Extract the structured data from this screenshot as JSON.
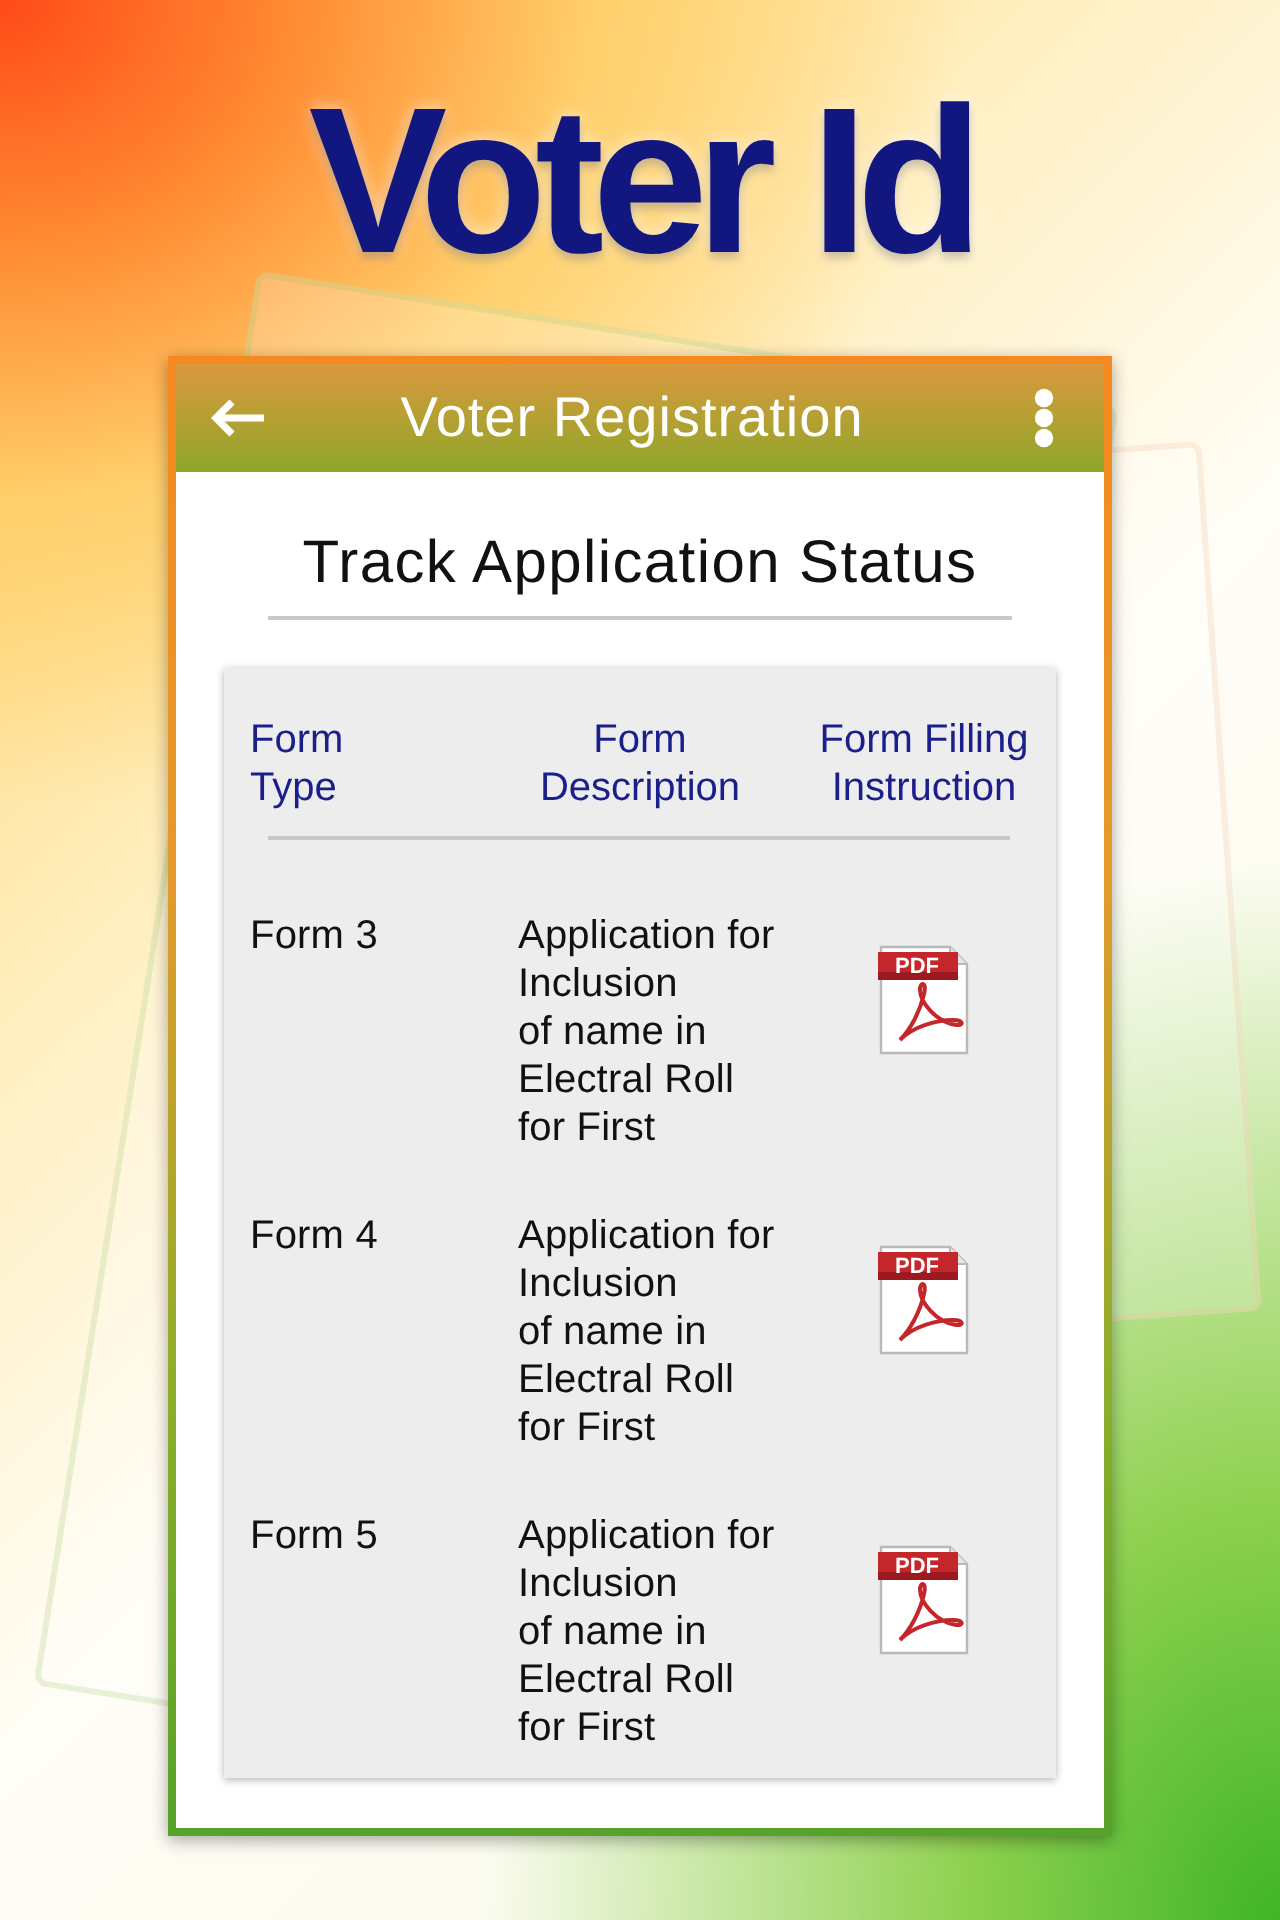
{
  "header": {
    "title": "Voter Id"
  },
  "app_bar": {
    "title": "Voter Registration"
  },
  "heading": "Track Application Status",
  "table": {
    "columns": [
      "Form\nType",
      "Form\nDescription",
      "Form Filling\nInstruction"
    ],
    "rows": [
      {
        "form": "Form 3",
        "description": "Application for\nInclusion\nof name in\nElectral Roll\nfor First",
        "instruction": {
          "kind": "pdf",
          "label": "PDF"
        }
      },
      {
        "form": "Form 4",
        "description": "Application for\nInclusion\nof name in\nElectral Roll\nfor First",
        "instruction": {
          "kind": "pdf",
          "label": "PDF"
        }
      },
      {
        "form": "Form 5",
        "description": "Application for\nInclusion\nof name in\nElectral Roll\nfor First",
        "instruction": {
          "kind": "pdf",
          "label": "PDF"
        }
      }
    ]
  }
}
